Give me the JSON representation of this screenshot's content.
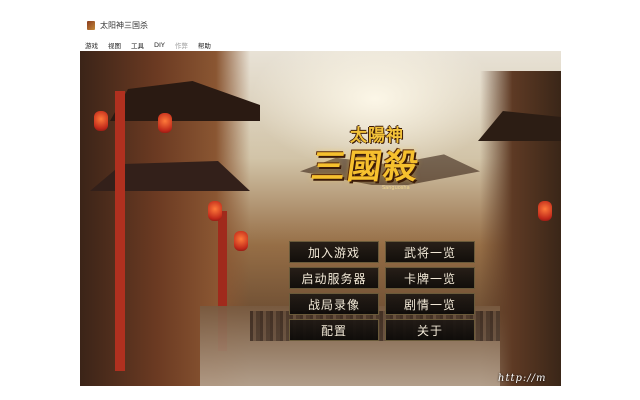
{
  "window": {
    "title": "太阳神三国杀",
    "menu": [
      "游戏",
      "视图",
      "工具",
      "DIY",
      "作弊",
      "帮助"
    ],
    "menu_disabled": [
      false,
      false,
      false,
      false,
      true,
      false
    ]
  },
  "logo": {
    "top_text": "太陽神",
    "main_text": "三國殺",
    "sub_text": "Sanguosha"
  },
  "buttons": {
    "join_game": "加入游戏",
    "generals_list": "武将一览",
    "start_server": "启动服务器",
    "cards_list": "卡牌一览",
    "replay": "战局录像",
    "story_list": "剧情一览",
    "config": "配置",
    "about": "关于"
  },
  "watermark": "http://m"
}
